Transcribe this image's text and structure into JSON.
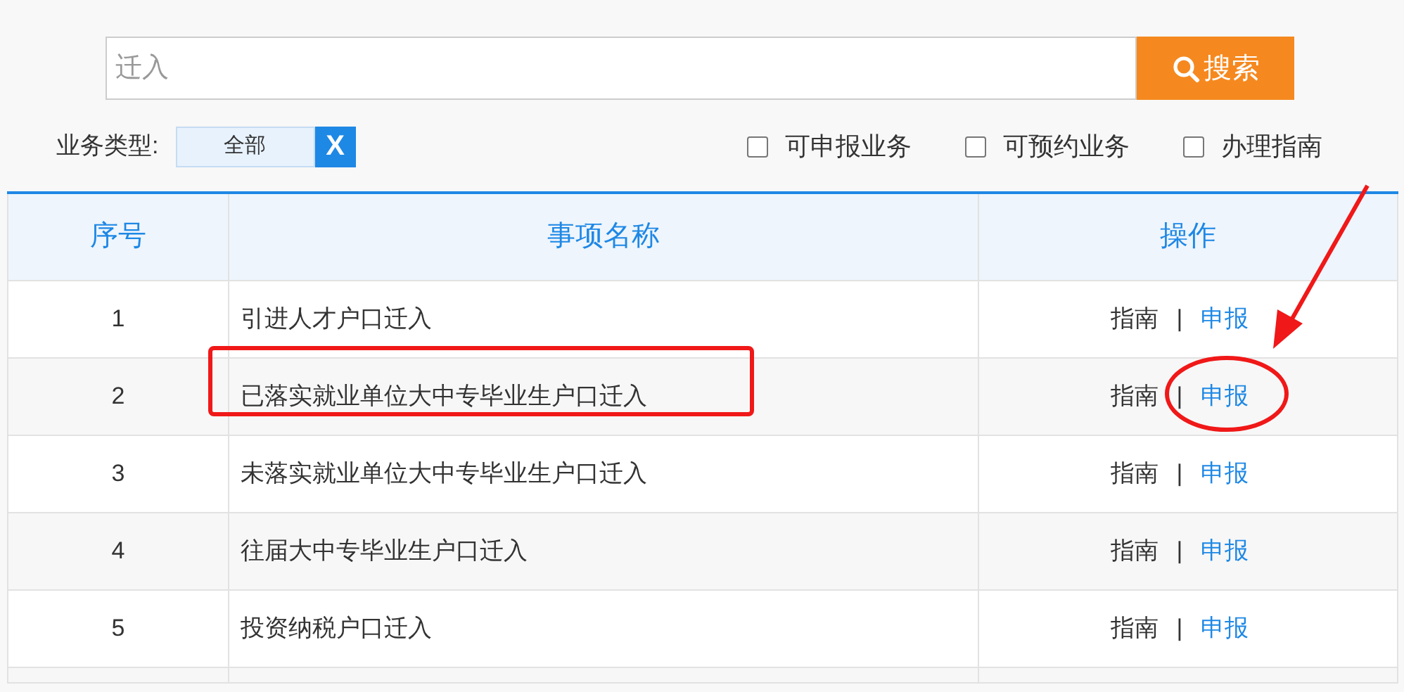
{
  "search": {
    "placeholder": "迁入",
    "button": "搜索"
  },
  "filter": {
    "label": "业务类型:",
    "value": "全部",
    "clear": "X"
  },
  "options": [
    {
      "label": "可申报业务",
      "checked": false
    },
    {
      "label": "可预约业务",
      "checked": false
    },
    {
      "label": "办理指南",
      "checked": false
    }
  ],
  "table": {
    "columns": [
      "序号",
      "事项名称",
      "操作"
    ],
    "rows": [
      {
        "no": "1",
        "name": "引进人才户口迁入",
        "guide": "指南",
        "separator": "|",
        "apply": "申报",
        "name_marked": false,
        "apply_marked": false
      },
      {
        "no": "2",
        "name": "已落实就业单位大中专毕业生户口迁入",
        "guide": "指南",
        "separator": "|",
        "apply": "申报",
        "name_marked": true,
        "apply_marked": true
      },
      {
        "no": "3",
        "name": "未落实就业单位大中专毕业生户口迁入",
        "guide": "指南",
        "separator": "|",
        "apply": "申报",
        "name_marked": false,
        "apply_marked": false
      },
      {
        "no": "4",
        "name": "往届大中专毕业生户口迁入",
        "guide": "指南",
        "separator": "|",
        "apply": "申报",
        "name_marked": false,
        "apply_marked": false
      },
      {
        "no": "5",
        "name": "投资纳税户口迁入",
        "guide": "指南",
        "separator": "|",
        "apply": "申报",
        "name_marked": false,
        "apply_marked": false
      }
    ]
  }
}
